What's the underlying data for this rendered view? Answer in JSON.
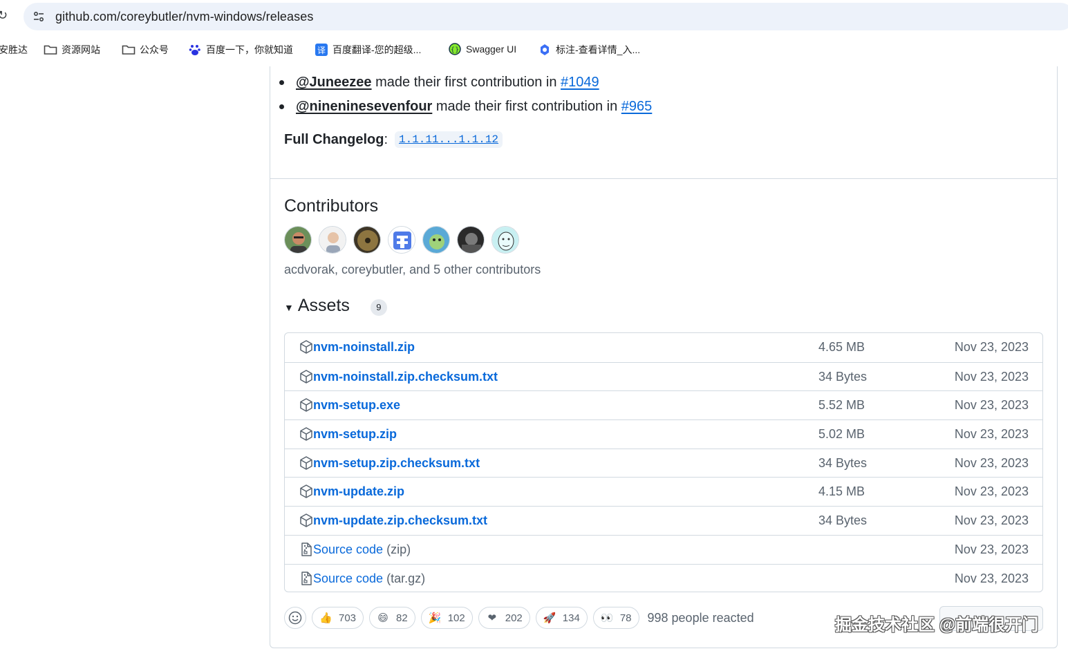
{
  "browser": {
    "url": "github.com/coreybutler/nvm-windows/releases",
    "bookmarks": [
      {
        "label": "安胜达",
        "icon": "none"
      },
      {
        "label": "资源网站",
        "icon": "folder-icon"
      },
      {
        "label": "公众号",
        "icon": "folder-icon"
      },
      {
        "label": "百度一下，你就知道",
        "icon": "baidu-icon"
      },
      {
        "label": "百度翻译-您的超级...",
        "icon": "translate-icon"
      },
      {
        "label": "Swagger UI",
        "icon": "swagger-icon"
      },
      {
        "label": "标注-查看详情_入...",
        "icon": "annotate-icon"
      }
    ]
  },
  "release": {
    "new_contributors": [
      {
        "user": "@Juneezee",
        "text": "made their first contribution in",
        "pr": "#1049"
      },
      {
        "user": "@nineninesevenfour",
        "text": "made their first contribution in",
        "pr": "#965"
      }
    ],
    "changelog_label": "Full Changelog",
    "changelog_sep": ":",
    "changelog_link": "1.1.11...1.1.12",
    "contributors_title": "Contributors",
    "contributors_summary": "acdvorak, coreybutler, and 5 other contributors",
    "assets_title": "Assets",
    "assets_count": "9",
    "assets": [
      {
        "name": "nvm-noinstall.zip",
        "suffix": "",
        "size": "4.65 MB",
        "date": "Nov 23, 2023",
        "kind": "package"
      },
      {
        "name": "nvm-noinstall.zip.checksum.txt",
        "suffix": "",
        "size": "34 Bytes",
        "date": "Nov 23, 2023",
        "kind": "package"
      },
      {
        "name": "nvm-setup.exe",
        "suffix": "",
        "size": "5.52 MB",
        "date": "Nov 23, 2023",
        "kind": "package"
      },
      {
        "name": "nvm-setup.zip",
        "suffix": "",
        "size": "5.02 MB",
        "date": "Nov 23, 2023",
        "kind": "package"
      },
      {
        "name": "nvm-setup.zip.checksum.txt",
        "suffix": "",
        "size": "34 Bytes",
        "date": "Nov 23, 2023",
        "kind": "package"
      },
      {
        "name": "nvm-update.zip",
        "suffix": "",
        "size": "4.15 MB",
        "date": "Nov 23, 2023",
        "kind": "package"
      },
      {
        "name": "nvm-update.zip.checksum.txt",
        "suffix": "",
        "size": "34 Bytes",
        "date": "Nov 23, 2023",
        "kind": "package"
      },
      {
        "name": "Source code",
        "suffix": "(zip)",
        "size": "",
        "date": "Nov 23, 2023",
        "kind": "source"
      },
      {
        "name": "Source code",
        "suffix": "(tar.gz)",
        "size": "",
        "date": "Nov 23, 2023",
        "kind": "source"
      }
    ],
    "reactions": [
      {
        "emoji": "👍",
        "name": "thumbs-up",
        "count": "703"
      },
      {
        "emoji": "😄",
        "name": "laugh",
        "count": "82"
      },
      {
        "emoji": "🎉",
        "name": "hooray",
        "count": "102"
      },
      {
        "emoji": "❤",
        "name": "heart",
        "count": "202"
      },
      {
        "emoji": "🚀",
        "name": "rocket",
        "count": "134"
      },
      {
        "emoji": "👀",
        "name": "eyes",
        "count": "78"
      }
    ],
    "reactions_summary": "998 people reacted"
  },
  "watermark": "掘金技术社区 @前端很开门",
  "colors": {
    "link": "#0969da",
    "muted": "#59636e",
    "border": "#d1d9e0",
    "text": "#1f2328"
  }
}
